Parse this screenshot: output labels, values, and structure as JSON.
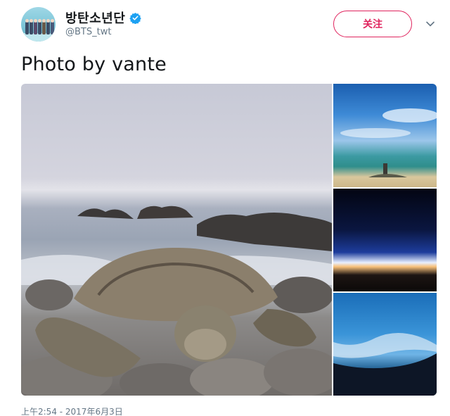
{
  "tweet": {
    "display_name": "방탄소년단",
    "handle": "@BTS_twt",
    "verified_icon": "verified-badge-icon",
    "follow_label": "关注",
    "menu_icon": "chevron-down-icon",
    "text": "Photo by vante",
    "timestamp": "上午2:54 - 2017年6月3日"
  },
  "colors": {
    "accent": "#e0245e",
    "verified": "#1da1f2",
    "secondary_text": "#657786"
  }
}
